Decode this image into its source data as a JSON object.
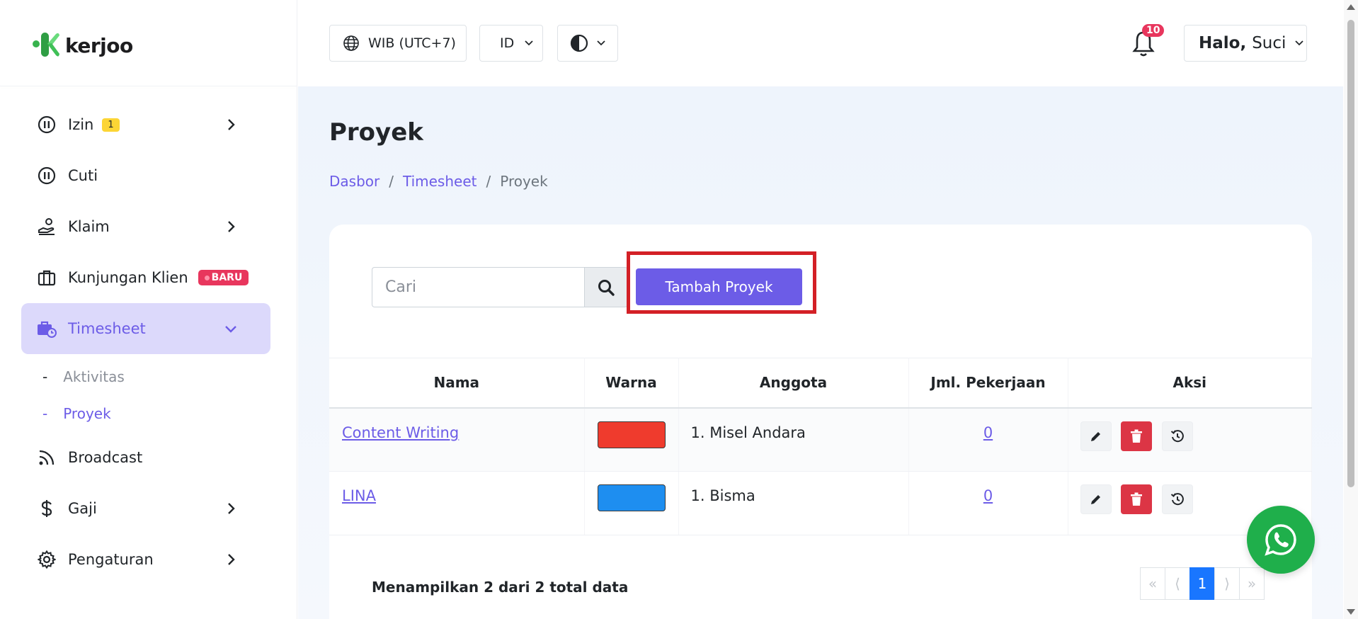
{
  "brand": {
    "name": "kerjoo"
  },
  "sidebar": {
    "items": [
      {
        "label": "Izin",
        "icon": "pause-circle-icon",
        "badge": "1",
        "has_chevron": true
      },
      {
        "label": "Cuti",
        "icon": "pause-circle-icon"
      },
      {
        "label": "Klaim",
        "icon": "hand-coin-icon",
        "has_chevron": true
      },
      {
        "label": "Kunjungan Klien",
        "icon": "briefcase-icon",
        "badge": "BARU"
      },
      {
        "label": "Timesheet",
        "icon": "briefcase-clock-icon",
        "active": true,
        "expanded": true
      },
      {
        "label": "Broadcast",
        "icon": "rss-icon"
      },
      {
        "label": "Gaji",
        "icon": "dollar-icon",
        "has_chevron": true
      },
      {
        "label": "Pengaturan",
        "icon": "gear-icon",
        "has_chevron": true
      }
    ],
    "subitems": [
      {
        "label": "Aktivitas"
      },
      {
        "label": "Proyek",
        "active": true
      }
    ]
  },
  "header": {
    "timezone": "WIB (UTC+7)",
    "language": "ID",
    "notification_count": "10",
    "greeting": "Halo,",
    "user_name": "Suci"
  },
  "page": {
    "title": "Proyek",
    "breadcrumb": [
      "Dasbor",
      "Timesheet",
      "Proyek"
    ],
    "search_placeholder": "Cari",
    "add_button": "Tambah Proyek"
  },
  "table": {
    "columns": [
      "Nama",
      "Warna",
      "Anggota",
      "Jml. Pekerjaan",
      "Aksi"
    ],
    "rows": [
      {
        "nama": "Content Writing",
        "warna": "#ef3b2d",
        "anggota": "1. Misel Andara",
        "jml": "0"
      },
      {
        "nama": "LINA",
        "warna": "#1e8ef0",
        "anggota": "1. Bisma",
        "jml": "0"
      }
    ]
  },
  "footer": {
    "summary": "Menampilkan 2 dari 2 total data",
    "pagination": {
      "first": "«",
      "prev": "⟨",
      "current": "1",
      "next": "⟩",
      "last": "»"
    }
  },
  "colors": {
    "accent": "#6c5ce7",
    "danger": "#dc3545",
    "highlight": "#d32026",
    "whatsapp": "#1faf4b"
  }
}
